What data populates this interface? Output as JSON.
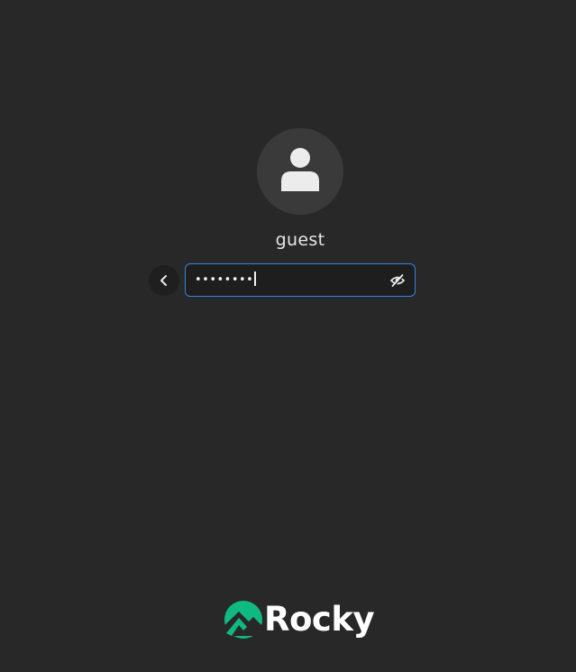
{
  "user": {
    "name": "guest"
  },
  "password": {
    "masked_value": "••••••••"
  },
  "branding": {
    "logo_text": "Rocky",
    "logo_color": "#10b981"
  },
  "icons": {
    "avatar": "user-silhouette-icon",
    "back": "chevron-left-icon",
    "reveal": "eye-slash-icon"
  },
  "colors": {
    "background": "#282828",
    "focus_ring": "#3584e4"
  }
}
